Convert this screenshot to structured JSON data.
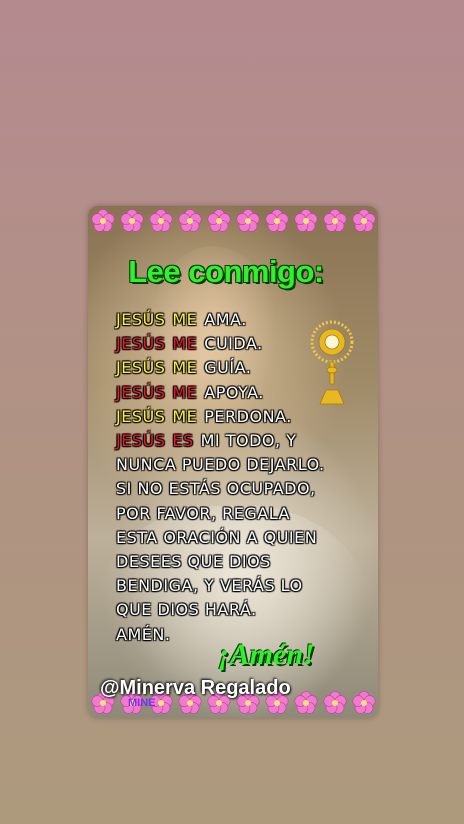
{
  "card": {
    "title": "Lee conmigo:",
    "lines": [
      {
        "parts": [
          {
            "text": "JESÚS",
            "color": "yellow"
          },
          {
            "text": "ME",
            "color": "yellow"
          },
          {
            "text": "AMA.",
            "color": "white"
          }
        ]
      },
      {
        "parts": [
          {
            "text": "JESÚS",
            "color": "red"
          },
          {
            "text": "ME",
            "color": "red"
          },
          {
            "text": "CUIDA.",
            "color": "white"
          }
        ]
      },
      {
        "parts": [
          {
            "text": "JESÚS",
            "color": "yellow"
          },
          {
            "text": "ME",
            "color": "yellow"
          },
          {
            "text": "GUÍA.",
            "color": "white"
          }
        ]
      },
      {
        "parts": [
          {
            "text": "JESÚS",
            "color": "red"
          },
          {
            "text": "ME",
            "color": "red"
          },
          {
            "text": "APOYA.",
            "color": "white"
          }
        ]
      },
      {
        "parts": [
          {
            "text": "JESÚS",
            "color": "yellow"
          },
          {
            "text": "ME",
            "color": "yellow"
          },
          {
            "text": "PERDONA.",
            "color": "white"
          }
        ]
      },
      {
        "parts": [
          {
            "text": "JESÚS",
            "color": "red"
          },
          {
            "text": "ES",
            "color": "red"
          },
          {
            "text": "MI TODO, Y",
            "color": "white"
          }
        ]
      },
      {
        "parts": [
          {
            "text": "NUNCA PUEDO DEJARLO.",
            "color": "white"
          }
        ]
      },
      {
        "parts": [
          {
            "text": "SI NO ESTÁS OCUPADO,",
            "color": "white"
          }
        ]
      },
      {
        "parts": [
          {
            "text": "POR FAVOR, REGALA",
            "color": "white"
          }
        ]
      },
      {
        "parts": [
          {
            "text": "ESTA ORACIÓN A QUIEN",
            "color": "white"
          }
        ]
      },
      {
        "parts": [
          {
            "text": "DESEES QUE DIOS",
            "color": "white"
          }
        ]
      },
      {
        "parts": [
          {
            "text": "BENDIGA, Y VERÁS LO",
            "color": "white"
          }
        ]
      },
      {
        "parts": [
          {
            "text": "QUE DIOS HARÁ.",
            "color": "white"
          }
        ]
      },
      {
        "parts": [
          {
            "text": "AMÉN.",
            "color": "white"
          }
        ]
      }
    ],
    "closing": "¡Amén!",
    "watermark": "@Minerva Regalado",
    "tag": "MINE"
  },
  "colors": {
    "title_green": "#2ef22a",
    "yellow": "#fff23a",
    "red": "#e41c2c",
    "flower_pink": "#f07ad0"
  },
  "icons": [
    "flower-icon",
    "monstrance-icon"
  ]
}
